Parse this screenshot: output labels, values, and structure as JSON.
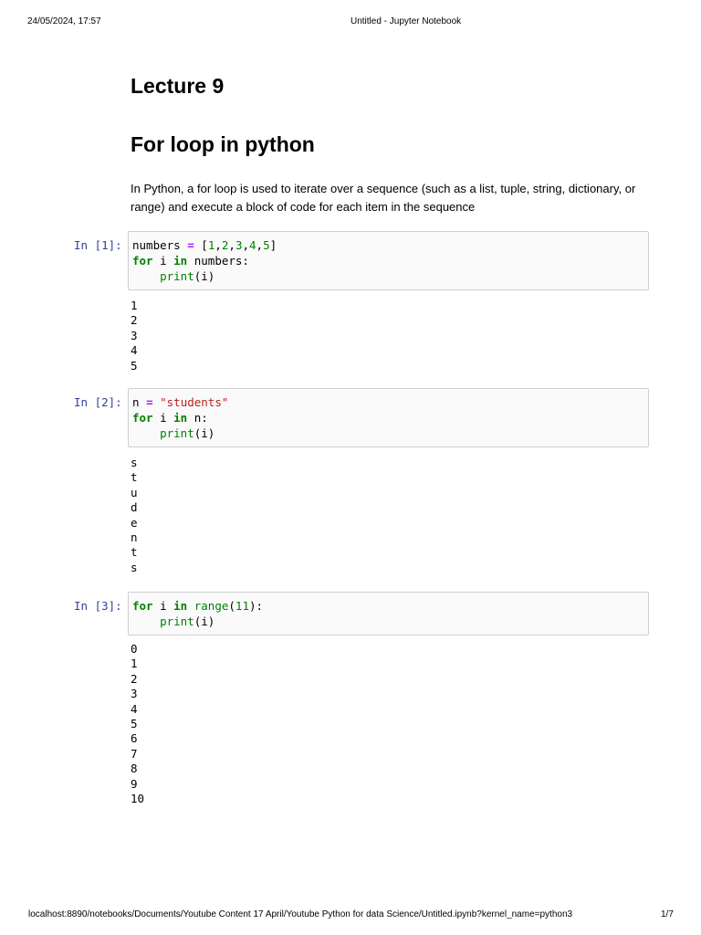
{
  "header": {
    "datetime": "24/05/2024, 17:57",
    "title": "Untitled - Jupyter Notebook"
  },
  "footer": {
    "url": "localhost:8890/notebooks/Documents/Youtube Content 17 April/Youtube Python for data Science/Untitled.ipynb?kernel_name=python3",
    "page": "1/7"
  },
  "headings": [
    "Lecture 9",
    "For loop in python"
  ],
  "paragraph": "In Python, a for loop is used to iterate over a sequence (such as a list, tuple, string, dictionary, or range) and execute a block of code for each item in the sequence",
  "cells": [
    {
      "prompt": "In [1]:",
      "lines": [
        [
          [
            "n",
            "numbers "
          ],
          [
            "op",
            "="
          ],
          [
            "n",
            " ["
          ],
          [
            "num",
            "1"
          ],
          [
            "n",
            ","
          ],
          [
            "num",
            "2"
          ],
          [
            "n",
            ","
          ],
          [
            "num",
            "3"
          ],
          [
            "n",
            ","
          ],
          [
            "num",
            "4"
          ],
          [
            "n",
            ","
          ],
          [
            "num",
            "5"
          ],
          [
            "n",
            "]"
          ]
        ],
        [
          [
            "kw",
            "for"
          ],
          [
            "n",
            " i "
          ],
          [
            "kw",
            "in"
          ],
          [
            "n",
            " numbers:"
          ]
        ],
        [
          [
            "n",
            "    "
          ],
          [
            "bi",
            "print"
          ],
          [
            "n",
            "(i)"
          ]
        ]
      ],
      "output": [
        "1",
        "2",
        "3",
        "4",
        "5"
      ]
    },
    {
      "prompt": "In [2]:",
      "lines": [
        [
          [
            "n",
            "n "
          ],
          [
            "op",
            "="
          ],
          [
            "n",
            " "
          ],
          [
            "str",
            "\"students\""
          ]
        ],
        [
          [
            "kw",
            "for"
          ],
          [
            "n",
            " i "
          ],
          [
            "kw",
            "in"
          ],
          [
            "n",
            " n:"
          ]
        ],
        [
          [
            "n",
            "    "
          ],
          [
            "bi",
            "print"
          ],
          [
            "n",
            "(i)"
          ]
        ]
      ],
      "output": [
        "s",
        "t",
        "u",
        "d",
        "e",
        "n",
        "t",
        "s"
      ]
    },
    {
      "prompt": "In [3]:",
      "lines": [
        [
          [
            "kw",
            "for"
          ],
          [
            "n",
            " i "
          ],
          [
            "kw",
            "in"
          ],
          [
            "n",
            " "
          ],
          [
            "bi",
            "range"
          ],
          [
            "n",
            "("
          ],
          [
            "num",
            "11"
          ],
          [
            "n",
            "):"
          ]
        ],
        [
          [
            "n",
            "    "
          ],
          [
            "bi",
            "print"
          ],
          [
            "n",
            "(i)"
          ]
        ]
      ],
      "output": [
        "0",
        "1",
        "2",
        "3",
        "4",
        "5",
        "6",
        "7",
        "8",
        "9",
        "10"
      ]
    }
  ]
}
